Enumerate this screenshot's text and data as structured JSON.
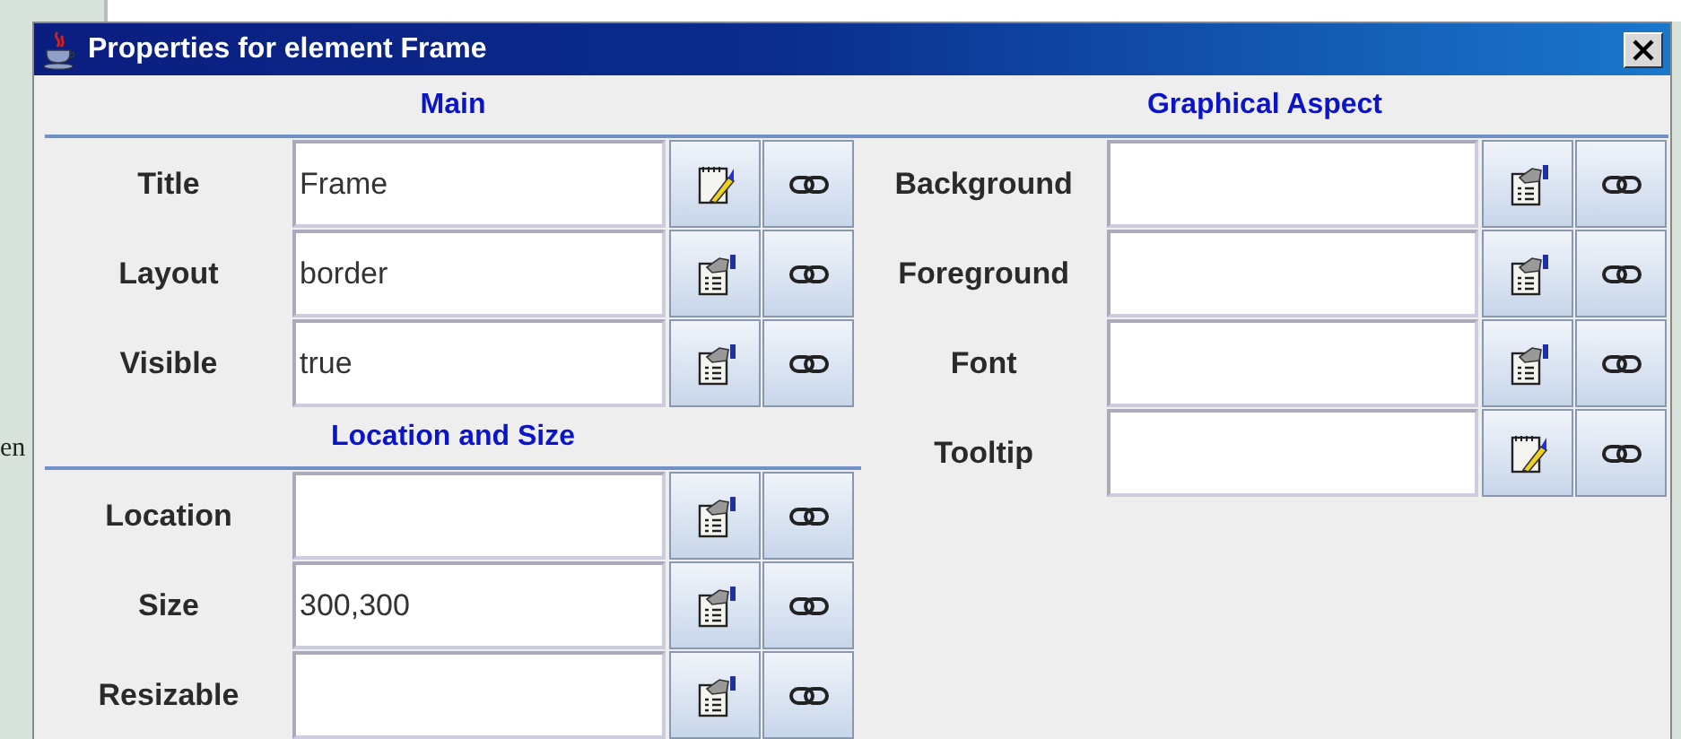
{
  "background_text": "en",
  "window": {
    "title": "Properties for element Frame"
  },
  "left_sections": [
    {
      "title": "Main",
      "rows": [
        {
          "label": "Title",
          "value": "Frame",
          "kind": "text"
        },
        {
          "label": "Layout",
          "value": "border",
          "kind": "form"
        },
        {
          "label": "Visible",
          "value": "true",
          "kind": "form"
        }
      ]
    },
    {
      "title": "Location and Size",
      "rows": [
        {
          "label": "Location",
          "kind": "form"
        },
        {
          "label": "Size",
          "value": "300,300",
          "kind": "form"
        },
        {
          "label": "Resizable",
          "kind": "form"
        }
      ]
    }
  ],
  "right_sections": [
    {
      "title": "Graphical Aspect",
      "rows": [
        {
          "label": "Background",
          "kind": "form"
        },
        {
          "label": "Foreground",
          "kind": "form"
        },
        {
          "label": "Font",
          "kind": "form"
        },
        {
          "label": "Tooltip",
          "kind": "text"
        }
      ]
    }
  ]
}
